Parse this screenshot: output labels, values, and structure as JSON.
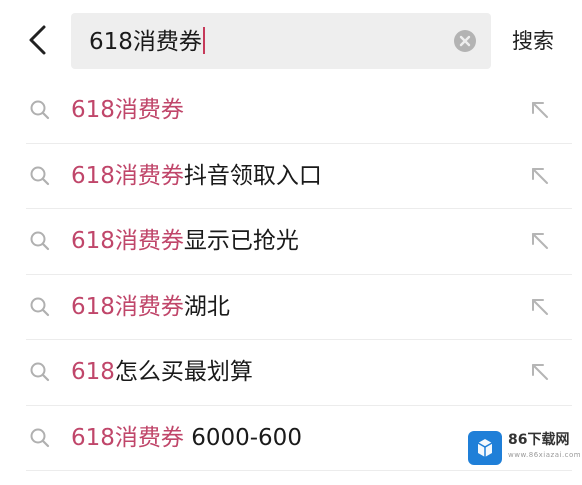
{
  "search": {
    "query": "618消费券",
    "submit_label": "搜索"
  },
  "suggestions": [
    {
      "highlight": "618消费券",
      "rest": ""
    },
    {
      "highlight": "618消费券",
      "rest": "抖音领取入口"
    },
    {
      "highlight": "618消费券",
      "rest": "显示已抢光"
    },
    {
      "highlight": "618消费券",
      "rest": "湖北"
    },
    {
      "highlight": "618",
      "rest": "怎么买最划算"
    },
    {
      "highlight": "618消费券",
      "rest": " 6000-600"
    }
  ],
  "watermark": {
    "name": "86下载网",
    "sub": "www.86xiazai.com"
  },
  "colors": {
    "highlight": "#c0466a",
    "caret": "#c63a5a",
    "search_bg": "#eeeeee",
    "text": "#1a1a1a",
    "icon_gray": "#b0b0b0"
  },
  "icons": {
    "back": "chevron-left-icon",
    "clear": "clear-circle-icon",
    "search": "search-icon",
    "fill": "arrow-up-left-icon"
  }
}
